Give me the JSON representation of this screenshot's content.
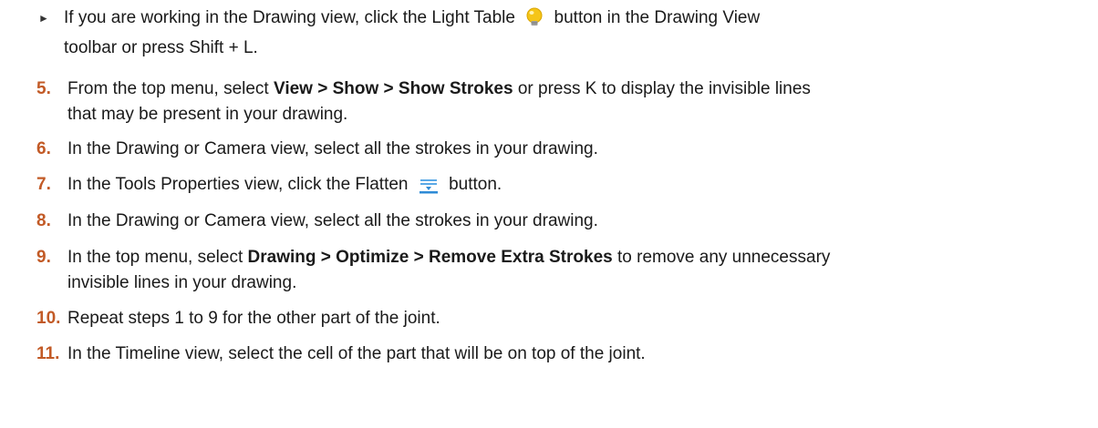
{
  "bullet": {
    "part1": "If you are working in the Drawing view, click the Light Table",
    "icon": "light-bulb-icon",
    "part2": "button in the Drawing View",
    "part3": "toolbar or press Shift + L."
  },
  "steps": [
    {
      "num": "5.",
      "pre": "From the top menu, select ",
      "bold": "View > Show > Show Strokes",
      "post": " or press K to display the invisible lines",
      "line2": "that may be present in your drawing."
    },
    {
      "num": "6.",
      "text": "In the Drawing or Camera view, select all the strokes in your drawing."
    },
    {
      "num": "7.",
      "pre": "In the Tools Properties view, click the Flatten",
      "icon": "flatten-icon",
      "post": "button."
    },
    {
      "num": "8.",
      "text": "In the Drawing or Camera view, select all the strokes in your drawing."
    },
    {
      "num": "9.",
      "pre": "In the top menu, select ",
      "bold": "Drawing > Optimize > Remove Extra Strokes",
      "post": " to remove any unnecessary",
      "line2": "invisible lines in your drawing."
    },
    {
      "num": "10.",
      "text": "Repeat steps 1 to 9 for the other part of the joint."
    },
    {
      "num": "11.",
      "text": "In the Timeline view, select the cell of the part that will be on top of the joint."
    }
  ],
  "colors": {
    "step_number": "#c25a26",
    "bulb": "#f5c518",
    "flatten": "#2e8bd6"
  }
}
